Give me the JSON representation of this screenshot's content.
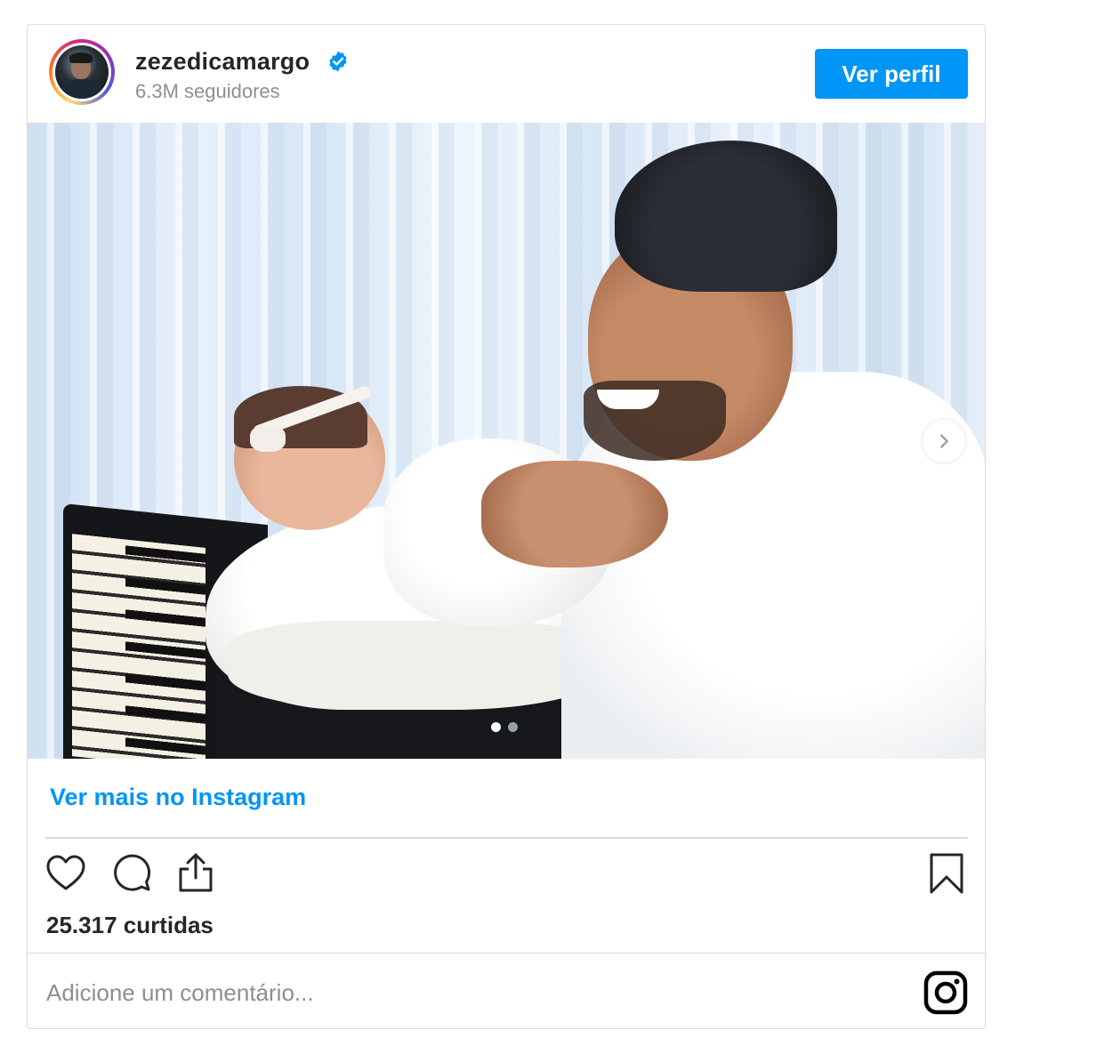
{
  "header": {
    "username": "zezedicamargo",
    "followers": "6.3M seguidores",
    "profile_button": "Ver perfil"
  },
  "post": {
    "carousel_total": 2,
    "carousel_current": 1,
    "more_link": "Ver mais no Instagram",
    "likes": "25.317 curtidas",
    "comment_placeholder": "Adicione um comentário..."
  },
  "icons": {
    "verified": "verified-badge-icon",
    "like": "heart-icon",
    "comment": "comment-bubble-icon",
    "share": "share-icon",
    "save": "bookmark-icon",
    "next": "chevron-right-icon",
    "logo": "instagram-icon"
  },
  "colors": {
    "accent": "#0095f6",
    "text": "#262626",
    "muted": "#8e8e8e",
    "border": "#dbdbdb"
  }
}
